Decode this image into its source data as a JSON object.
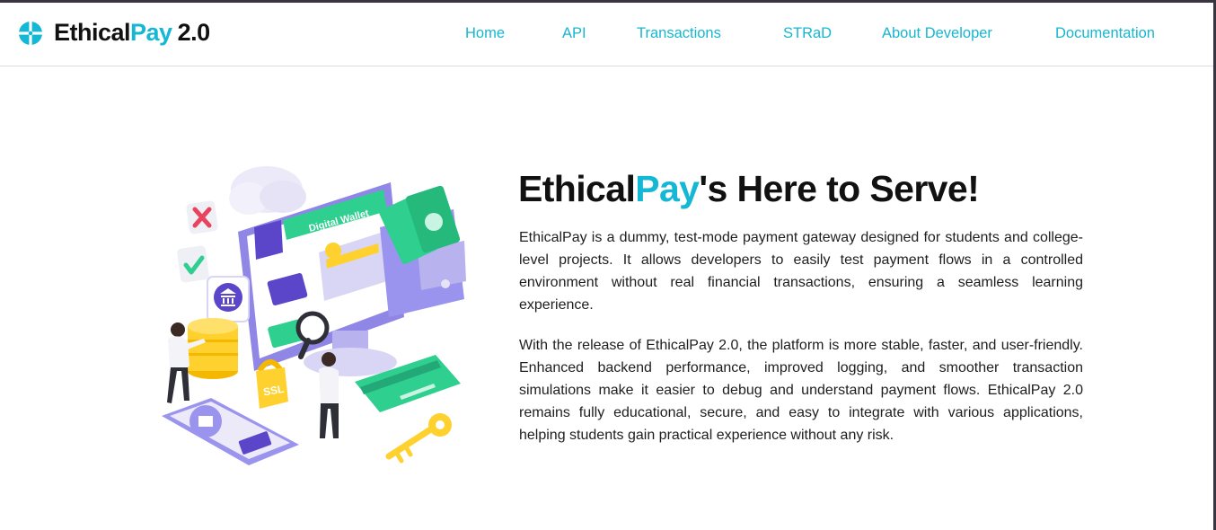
{
  "brand": {
    "name_part1": "Ethical",
    "name_part2": "Pay",
    "version": "2.0",
    "logo_icon": "brand-logo-icon"
  },
  "nav": {
    "links": [
      "Home",
      "API",
      "Transactions",
      "STRaD",
      "About Developer",
      "Documentation"
    ]
  },
  "colors": {
    "accent": "#14b8d4",
    "text": "#111111",
    "illustration_purple": "#8f86e6",
    "illustration_green": "#2fcf8f",
    "illustration_yellow": "#ffd12e"
  },
  "hero": {
    "heading_part1": "Ethical",
    "heading_part2": "Pay",
    "heading_part3": "'s Here to Serve!",
    "paragraph1": "EthicalPay is a dummy, test-mode payment gateway designed for students and college-level projects. It allows developers to easily test payment flows in a controlled environment without real financial transactions, ensuring a seamless learning experience.",
    "paragraph2": "With the release of EthicalPay 2.0, the platform is more stable, faster, and user-friendly. Enhanced backend performance, improved logging, and smoother transaction simulations make it easier to debug and understand payment flows. EthicalPay 2.0 remains fully educational, secure, and easy to integrate with various applications, helping students gain practical experience without any risk."
  },
  "illustration": {
    "wallet_label": "Digital Wallet",
    "lock_label": "SSL",
    "icons": [
      "cloud-icon",
      "cross-icon",
      "check-icon",
      "bank-icon",
      "magnifier-icon",
      "key-icon",
      "credit-card-icon",
      "cash-icon"
    ]
  }
}
